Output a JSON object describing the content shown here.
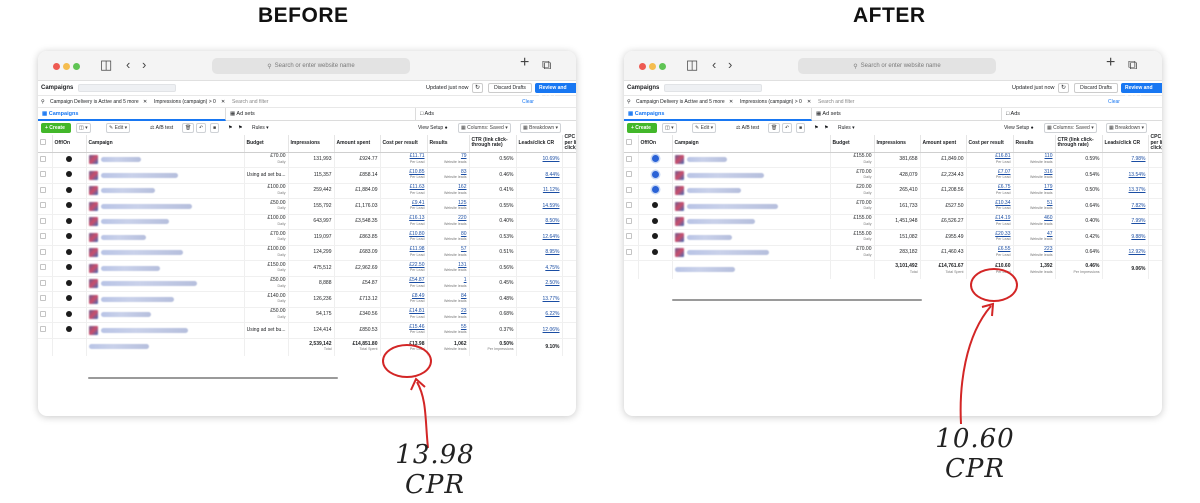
{
  "labels": {
    "before": "BEFORE",
    "after": "AFTER"
  },
  "browser": {
    "search_placeholder": "Search or enter website name"
  },
  "app": {
    "title": "Campaigns",
    "updated": "Updated just now",
    "discard": "Discard Drafts",
    "review": "Review and Publish"
  },
  "filters": {
    "chip1": "Campaign Delivery is Active and 5 more",
    "chip2": "Impressions (campaign) > 0",
    "search": "Search and filter",
    "clear": "Clear"
  },
  "tabs": {
    "campaigns": "Campaigns",
    "adsets": "Ad sets",
    "ads": "Ads"
  },
  "toolbar": {
    "create": "+ Create",
    "edit": "Edit",
    "abtest": "A/B test",
    "rules": "Rules",
    "view_setup": "View Setup",
    "columns": "Columns: Saved",
    "breakdown": "Breakdown"
  },
  "columns": {
    "onoff": "Off/On",
    "campaign": "Campaign",
    "budget": "Budget",
    "impressions": "Impressions",
    "amount": "Amount spent",
    "cpr": "Cost per result",
    "results": "Results",
    "ctr": "CTR (link click-through rate)",
    "leads": "Leads/click CR",
    "cpc": "CPC (cost per link click)"
  },
  "units": {
    "daily": "Daily",
    "per_lead": "Per Lead",
    "website_leads": "Website leads",
    "total": "Total",
    "total_spent": "Total Spent",
    "per_impressions": "Per Impressions"
  },
  "before_rows": [
    {
      "budget": "£70.00",
      "budget_sub": "Daily",
      "impr": "131,993",
      "amount": "£924.77",
      "cpr": "£11.71",
      "results": "79",
      "ctr": "0.56%",
      "leads": "10.69%"
    },
    {
      "budget": "Using ad set bu...",
      "budget_sub": "",
      "impr": "115,357",
      "amount": "£858.14",
      "cpr": "£10.85",
      "results": "83",
      "ctr": "0.46%",
      "leads": "8.44%"
    },
    {
      "budget": "£100.00",
      "budget_sub": "Daily",
      "impr": "259,442",
      "amount": "£1,884.09",
      "cpr": "£11.63",
      "results": "162",
      "ctr": "0.41%",
      "leads": "11.12%"
    },
    {
      "budget": "£50.00",
      "budget_sub": "Daily",
      "impr": "155,792",
      "amount": "£1,176.03",
      "cpr": "£9.41",
      "results": "125",
      "ctr": "0.55%",
      "leads": "14.59%"
    },
    {
      "budget": "£100.00",
      "budget_sub": "Daily",
      "impr": "643,997",
      "amount": "£3,548.35",
      "cpr": "£16.13",
      "results": "220",
      "ctr": "0.40%",
      "leads": "8.50%"
    },
    {
      "budget": "£70.00",
      "budget_sub": "Daily",
      "impr": "119,097",
      "amount": "£863.85",
      "cpr": "£10.80",
      "results": "80",
      "ctr": "0.53%",
      "leads": "12.64%"
    },
    {
      "budget": "£100.00",
      "budget_sub": "Daily",
      "impr": "124,299",
      "amount": "£683.09",
      "cpr": "£11.98",
      "results": "57",
      "ctr": "0.51%",
      "leads": "8.95%"
    },
    {
      "budget": "£150.00",
      "budget_sub": "Daily",
      "impr": "475,512",
      "amount": "£2,962.69",
      "cpr": "£22.50",
      "results": "131",
      "ctr": "0.56%",
      "leads": "4.75%"
    },
    {
      "budget": "£50.00",
      "budget_sub": "Daily",
      "impr": "8,888",
      "amount": "£54.87",
      "cpr": "£54.87",
      "results": "1",
      "ctr": "0.45%",
      "leads": "2.50%"
    },
    {
      "budget": "£140.00",
      "budget_sub": "Daily",
      "impr": "126,236",
      "amount": "£713.12",
      "cpr": "£8.49",
      "results": "84",
      "ctr": "0.48%",
      "leads": "13.77%"
    },
    {
      "budget": "£50.00",
      "budget_sub": "Daily",
      "impr": "54,175",
      "amount": "£340.56",
      "cpr": "£14.81",
      "results": "23",
      "ctr": "0.68%",
      "leads": "6.22%"
    },
    {
      "budget": "Using ad set bu...",
      "budget_sub": "",
      "impr": "124,414",
      "amount": "£850.53",
      "cpr": "£15.46",
      "results": "55",
      "ctr": "0.37%",
      "leads": "12.06%"
    }
  ],
  "before_total": {
    "impr": "2,539,142",
    "amount": "£14,851.80",
    "cpr": "£13.98",
    "results": "1,062",
    "ctr": "0.50%",
    "leads": "9.10%"
  },
  "after_rows": [
    {
      "toggle": "blue",
      "budget": "£155.00",
      "budget_sub": "Daily",
      "impr": "381,658",
      "amount": "£1,849.00",
      "cpr": "£16.81",
      "results": "110",
      "ctr": "0.59%",
      "leads": "7.98%"
    },
    {
      "toggle": "blue",
      "budget": "£70.00",
      "budget_sub": "Daily",
      "impr": "428,079",
      "amount": "£2,234.43",
      "cpr": "£7.07",
      "results": "316",
      "ctr": "0.54%",
      "leads": "13.54%"
    },
    {
      "toggle": "blue",
      "budget": "£20.00",
      "budget_sub": "Daily",
      "impr": "265,410",
      "amount": "£1,208.56",
      "cpr": "£6.75",
      "results": "179",
      "ctr": "0.50%",
      "leads": "13.37%"
    },
    {
      "toggle": "black",
      "budget": "£70.00",
      "budget_sub": "Daily",
      "impr": "161,733",
      "amount": "£527.50",
      "cpr": "£10.34",
      "results": "51",
      "ctr": "0.64%",
      "leads": "7.82%"
    },
    {
      "toggle": "black",
      "budget": "£155.00",
      "budget_sub": "Daily",
      "impr": "1,451,948",
      "amount": "£6,526.27",
      "cpr": "£14.19",
      "results": "460",
      "ctr": "0.40%",
      "leads": "7.99%"
    },
    {
      "toggle": "black",
      "budget": "£155.00",
      "budget_sub": "Daily",
      "impr": "151,082",
      "amount": "£955.49",
      "cpr": "£20.33",
      "results": "47",
      "ctr": "0.42%",
      "leads": "9.88%"
    },
    {
      "toggle": "black",
      "budget": "£70.00",
      "budget_sub": "Daily",
      "impr": "283,182",
      "amount": "£1,460.43",
      "cpr": "£6.55",
      "results": "223",
      "ctr": "0.64%",
      "leads": "12.92%"
    }
  ],
  "after_total": {
    "impr": "3,101,492",
    "amount": "£14,761.67",
    "cpr": "£10.60",
    "results": "1,392",
    "ctr": "0.46%",
    "leads": "9.06%"
  },
  "annotations": {
    "before_line1": "13.98",
    "before_line2": "CPR",
    "after_line1": "10.60",
    "after_line2": "CPR"
  }
}
